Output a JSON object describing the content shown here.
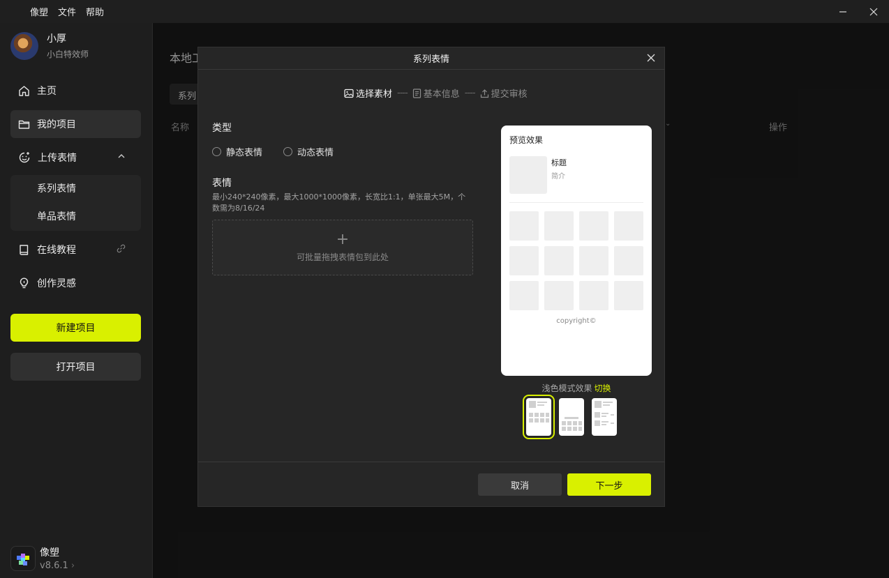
{
  "menubar": {
    "items": [
      "像塑",
      "文件",
      "帮助"
    ]
  },
  "user": {
    "name": "小厚",
    "role": "小白特效师"
  },
  "sidebar": {
    "items": [
      {
        "label": "主页",
        "icon": "home-icon"
      },
      {
        "label": "我的项目",
        "icon": "folder-icon"
      },
      {
        "label": "上传表情",
        "icon": "emoji-upload-icon"
      },
      {
        "label": "在线教程",
        "icon": "book-icon"
      },
      {
        "label": "创作灵感",
        "icon": "bulb-icon"
      }
    ],
    "subitems": [
      "系列表情",
      "单品表情"
    ],
    "new_project": "新建项目",
    "open_project": "打开项目"
  },
  "app": {
    "name": "像塑",
    "version": "v8.6.1"
  },
  "background": {
    "title": "本地工",
    "tab": "系列",
    "col_name": "名称",
    "col_action": "操作"
  },
  "modal": {
    "title": "系列表情",
    "steps": [
      {
        "label": "选择素材",
        "active": true
      },
      {
        "label": "基本信息",
        "active": false
      },
      {
        "label": "提交审核",
        "active": false
      }
    ],
    "step_separator": "----",
    "type_label": "类型",
    "type_options": [
      "静态表情",
      "动态表情"
    ],
    "sticker_label": "表情",
    "sticker_desc": "最小240*240像素，最大1000*1000像素，长宽比1:1，单张最大5M，个数需为8/16/24",
    "dropzone_hint": "可批量拖拽表情包到此处",
    "preview": {
      "title": "预览效果",
      "name": "标题",
      "intro": "简介",
      "copyright": "copyright©"
    },
    "mode_text": "浅色模式效果",
    "mode_switch": "切换",
    "cancel": "取消",
    "next": "下一步"
  },
  "colors": {
    "accent": "#d9f000",
    "background": "#1a1a1a",
    "modal": "#262626"
  }
}
